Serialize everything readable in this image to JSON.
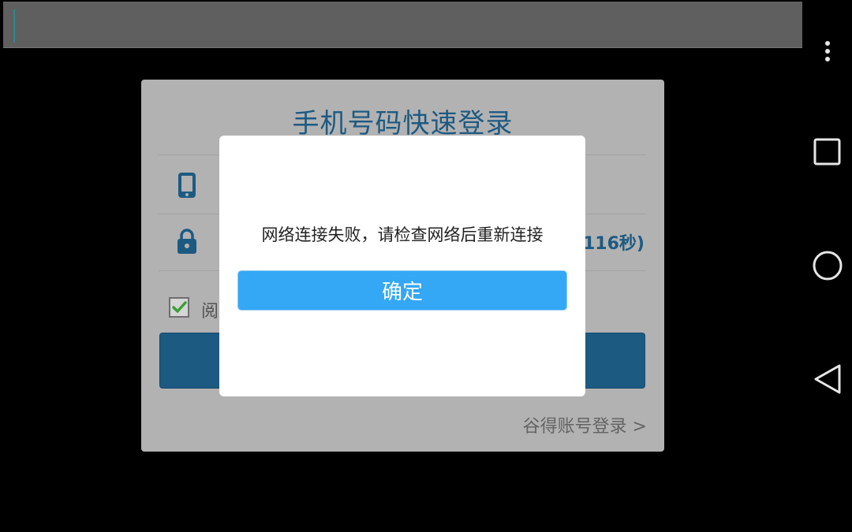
{
  "top_input": {
    "value": ""
  },
  "card": {
    "title": "手机号码快速登录",
    "countdown": "116秒)",
    "agreement_label": "阅",
    "alt_login_link": "谷得账号登录 >"
  },
  "dialog": {
    "message": "网络连接失败，请检查网络后重新连接",
    "confirm_label": "确定"
  },
  "icons": {
    "phone": "phone-icon",
    "lock": "lock-icon",
    "checkbox": "checkmark-icon",
    "menu": "more-vert-icon",
    "recents": "square-icon",
    "home": "circle-icon",
    "back": "triangle-back-icon"
  },
  "colors": {
    "accent": "#34a7f5",
    "card_title": "#1d5a82",
    "checkbox_mark": "#3aa03a"
  }
}
